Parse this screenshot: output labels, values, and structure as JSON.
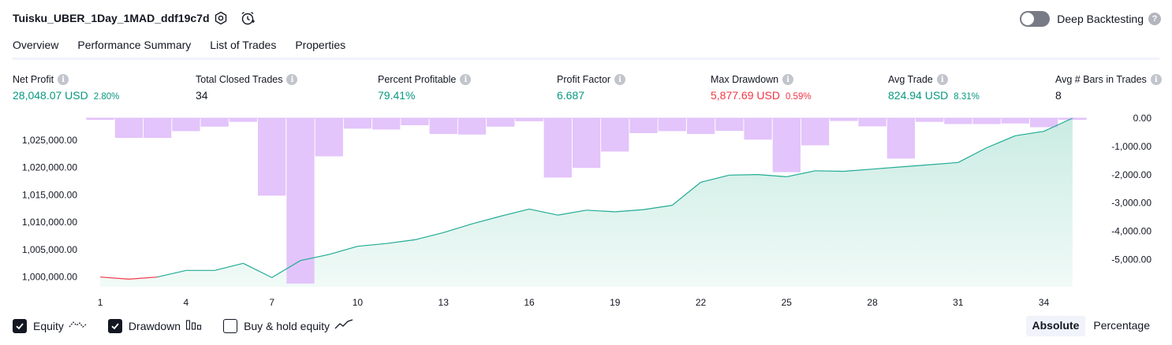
{
  "header": {
    "title": "Tuisku_UBER_1Day_1MAD_ddf19c7d",
    "settings_icon": "settings-gear-icon",
    "alert_icon": "add-alert-clock-icon",
    "deep_backtesting_label": "Deep Backtesting",
    "deep_backtesting_enabled": false,
    "help_glyph": "?"
  },
  "tabs": [
    {
      "label": "Overview",
      "active": true
    },
    {
      "label": "Performance Summary",
      "active": false
    },
    {
      "label": "List of Trades",
      "active": false
    },
    {
      "label": "Properties",
      "active": false
    }
  ],
  "metrics": [
    {
      "label": "Net Profit",
      "value": "28,048.07 USD",
      "pct": "2.80%",
      "color": "pos"
    },
    {
      "label": "Total Closed Trades",
      "value": "34",
      "pct": "",
      "color": "plain"
    },
    {
      "label": "Percent Profitable",
      "value": "79.41%",
      "pct": "",
      "color": "pos"
    },
    {
      "label": "Profit Factor",
      "value": "6.687",
      "pct": "",
      "color": "pos"
    },
    {
      "label": "Max Drawdown",
      "value": "5,877.69 USD",
      "pct": "0.59%",
      "color": "neg"
    },
    {
      "label": "Avg Trade",
      "value": "824.94 USD",
      "pct": "8.31%",
      "color": "pos"
    },
    {
      "label": "Avg # Bars in Trades",
      "value": "8",
      "pct": "",
      "color": "plain"
    }
  ],
  "info_glyph": "i",
  "colors": {
    "positive": "#089981",
    "negative": "#f23645",
    "drawdown_bar": "#e1bffb",
    "equity_line": "#22ab94",
    "equity_fill": "#c7ebe1",
    "text": "#131722"
  },
  "chart_data": {
    "type": "area",
    "x": [
      1,
      2,
      3,
      4,
      5,
      6,
      7,
      8,
      9,
      10,
      11,
      12,
      13,
      14,
      15,
      16,
      17,
      18,
      19,
      20,
      21,
      22,
      23,
      24,
      25,
      26,
      27,
      28,
      29,
      30,
      31,
      32,
      33,
      34,
      35
    ],
    "x_tick_labels": [
      "1",
      "4",
      "7",
      "10",
      "13",
      "16",
      "19",
      "22",
      "25",
      "28",
      "31",
      "34"
    ],
    "x_ticks": [
      1,
      4,
      7,
      10,
      13,
      16,
      19,
      22,
      25,
      28,
      31,
      34
    ],
    "left_axis": {
      "ylim": [
        998800,
        1029000
      ],
      "tick_labels": [
        "1,000,000.00",
        "1,005,000.00",
        "1,010,000.00",
        "1,015,000.00",
        "1,020,000.00",
        "1,025,000.00"
      ],
      "ticks": [
        1000000,
        1005000,
        1010000,
        1015000,
        1020000,
        1025000
      ]
    },
    "right_axis": {
      "ylim": [
        -5850,
        0
      ],
      "tick_labels": [
        "0.00",
        "-1,000.00",
        "-2,000.00",
        "-3,000.00",
        "-4,000.00",
        "-5,000.00"
      ],
      "ticks": [
        0,
        -1000,
        -2000,
        -3000,
        -4000,
        -5000
      ]
    },
    "series": [
      {
        "name": "Equity",
        "type": "area",
        "values": [
          1000000,
          999600,
          1000000,
          1001200,
          1001200,
          1002500,
          999900,
          1003000,
          1004100,
          1005600,
          1006100,
          1006800,
          1008100,
          1009700,
          1011100,
          1012400,
          1011300,
          1012200,
          1011900,
          1012300,
          1013100,
          1017300,
          1018600,
          1018700,
          1018300,
          1019400,
          1019300,
          1019700,
          1020100,
          1020500,
          1020900,
          1023600,
          1025800,
          1026600,
          1029000
        ]
      },
      {
        "name": "Drawdown",
        "type": "bar",
        "values": [
          -60,
          -700,
          -700,
          -460,
          -300,
          -130,
          -2740,
          -5850,
          -1350,
          -370,
          -400,
          -250,
          -560,
          -580,
          -300,
          -110,
          -2100,
          -1760,
          -1180,
          -530,
          -460,
          -560,
          -450,
          -760,
          -1910,
          -960,
          -100,
          -290,
          -1430,
          -130,
          -210,
          -210,
          -190,
          -320,
          -60
        ]
      }
    ]
  },
  "legend": [
    {
      "label": "Equity",
      "checked": true,
      "icon": "equity-line-icon"
    },
    {
      "label": "Drawdown",
      "checked": true,
      "icon": "drawdown-bars-icon"
    },
    {
      "label": "Buy & hold equity",
      "checked": false,
      "icon": "buy-hold-line-icon"
    }
  ],
  "view_modes": [
    {
      "label": "Absolute",
      "active": true
    },
    {
      "label": "Percentage",
      "active": false
    }
  ]
}
